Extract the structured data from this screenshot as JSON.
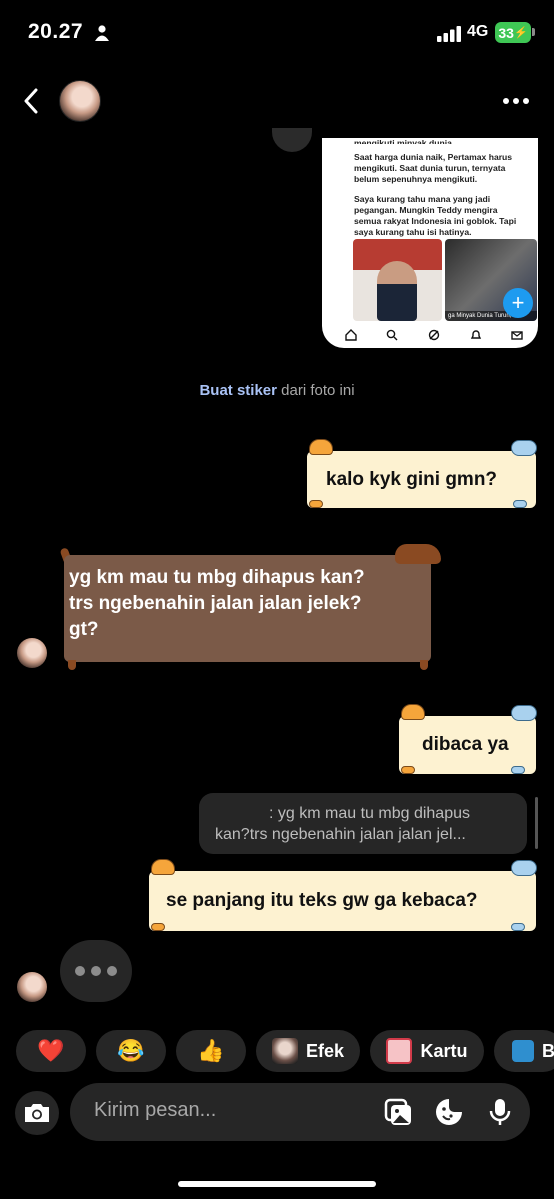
{
  "status_bar": {
    "time": "20.27",
    "network": "4G",
    "battery": "33"
  },
  "header": {
    "avatar": "contact-avatar"
  },
  "shared_post": {
    "partial_top": "mengikuti minyak dunia.",
    "paragraph_1": "Saat harga dunia naik, Pertamax harus mengikuti. Saat dunia turun, ternyata belum sepenuhnya mengikuti.",
    "paragraph_2": "Saya kurang tahu mana yang jadi pegangan. Mungkin Teddy mengira semua rakyat Indonesia ini goblok. Tapi saya kurang tahu isi hatinya.",
    "media_caption_left": "",
    "media_caption_right": "ga Minyak Dunia Turun, H"
  },
  "sticker_hint": {
    "action": "Buat stiker",
    "rest": " dari foto ini"
  },
  "messages": {
    "m1": "kalo kyk gini gmn?",
    "m2_line1": "yg km mau tu mbg dihapus kan?",
    "m2_line2": "trs ngebenahin jalan jalan jelek?",
    "m2_line3": "gt?",
    "m3": "dibaca ya",
    "reply_line1": ": yg km mau tu mbg dihapus",
    "reply_line2": "kan?trs ngebenahin jalan jalan jel...",
    "m5": "se panjang itu teks gw ga kebaca?"
  },
  "quick_replies": {
    "heart": "❤️",
    "laugh": "😂",
    "thumbs": "👍",
    "effects": "Efek",
    "cards": "Kartu",
    "partial": "B"
  },
  "composer": {
    "placeholder": "Kirim pesan..."
  },
  "colors": {
    "background": "#000000",
    "bubble_cream": "#fdf2d1",
    "bubble_brown": "#7b5a48",
    "surface": "#262626",
    "battery": "#3fc755",
    "link": "#a9c2f5"
  }
}
